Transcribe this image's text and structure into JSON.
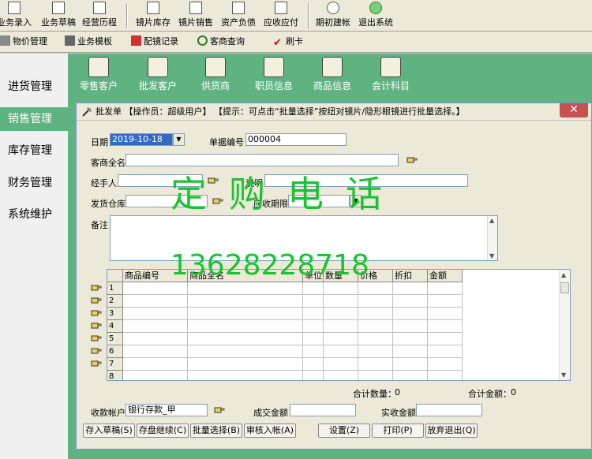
{
  "toolbar1": {
    "items": [
      {
        "label": "业务录入",
        "icon": "edit-icon"
      },
      {
        "label": "业务草稿",
        "icon": "draft-icon"
      },
      {
        "label": "经营历程",
        "icon": "history-icon"
      },
      {
        "label": "镜片库存",
        "icon": "inventory-icon"
      },
      {
        "label": "镜片销售",
        "icon": "sales-chart-icon"
      },
      {
        "label": "资产负债",
        "icon": "balance-icon"
      },
      {
        "label": "应收应付",
        "icon": "payment-icon"
      },
      {
        "label": "期初建帐",
        "icon": "setup-icon"
      },
      {
        "label": "退出系统",
        "icon": "exit-runner-icon"
      }
    ]
  },
  "toolbar2": {
    "items": [
      {
        "label": "物价管理",
        "icon": "price-icon"
      },
      {
        "label": "业务模板",
        "icon": "template-icon"
      },
      {
        "label": "配镜记录",
        "icon": "record-icon"
      },
      {
        "label": "客商查询",
        "icon": "query-icon"
      },
      {
        "label": "刷卡",
        "icon": "check-icon"
      }
    ]
  },
  "leftnav": {
    "items": [
      {
        "label": "进货管理",
        "active": false
      },
      {
        "label": "销售管理",
        "active": true
      },
      {
        "label": "库存管理",
        "active": false
      },
      {
        "label": "财务管理",
        "active": false
      },
      {
        "label": "系统维护",
        "active": false
      }
    ]
  },
  "modules": {
    "items": [
      {
        "label": "零售客户",
        "icon": "retail-customer-icon"
      },
      {
        "label": "批发客户",
        "icon": "wholesale-customer-icon"
      },
      {
        "label": "供货商",
        "icon": "supplier-icon"
      },
      {
        "label": "职员信息",
        "icon": "staff-icon"
      },
      {
        "label": "商品信息",
        "icon": "product-icon"
      },
      {
        "label": "会计科目",
        "icon": "accounting-icon"
      }
    ]
  },
  "dialog": {
    "title": "批发单 【操作员：超级用户】   【提示：可点击“批量选择”按纽对镜片/隐形眼镜进行批量选择。】",
    "close": "✕",
    "date_label": "日期",
    "date_value": "2019-10-18",
    "docno_label": "单据编号",
    "docno_value": "000004",
    "customer_label": "客商全名",
    "customer_value": "",
    "handler_label": "经手人",
    "handler_value": "",
    "desc_label": "说明",
    "desc_value": "",
    "warehouse_label": "发货仓库",
    "warehouse_value": "",
    "due_label": "应收期限",
    "due_value": "",
    "memo_label": "备注",
    "memo_value": "",
    "grid": {
      "columns": [
        "商品编号",
        "商品全名",
        "单位",
        "数量",
        "价格",
        "折扣",
        "金额"
      ],
      "rows": [
        "1",
        "2",
        "3",
        "4",
        "5",
        "6",
        "7",
        "8"
      ]
    },
    "total_qty_label": "合计数量：",
    "total_qty_value": "0",
    "total_amt_label": "合计金额：",
    "total_amt_value": "0",
    "account_label": "收款帐户",
    "account_value": "银行存款_甲",
    "deal_label": "成交金额",
    "deal_value": "",
    "paid_label": "实收金额",
    "paid_value": "",
    "buttons": [
      "存入草稿(S)",
      "存盘继续(C)",
      "批量选择(B)",
      "审核入帐(A)",
      "设置(Z)",
      "打印(P)",
      "放弃退出(Q)"
    ]
  },
  "watermark": {
    "line1": "定购电话",
    "line2": "13628228718"
  },
  "colors": {
    "accent_green": "#5fb381",
    "selection_blue": "#316ac5",
    "watermark_green": "#19c332"
  }
}
